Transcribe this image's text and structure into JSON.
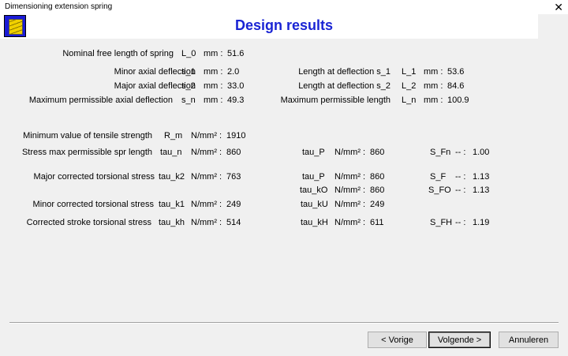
{
  "window": {
    "title": "Dimensioning extension spring",
    "close_glyph": "✕"
  },
  "heading": "Design results",
  "rows": {
    "free_length": {
      "label": "Nominal free length of spring",
      "sym": "L_0",
      "unit": "mm :",
      "val": "51.6"
    },
    "s1": {
      "label": "Minor axial deflection",
      "sym": "s_1",
      "unit": "mm :",
      "val": "2.0"
    },
    "s2": {
      "label": "Major axial deflection",
      "sym": "s_2",
      "unit": "mm :",
      "val": "33.0"
    },
    "sn": {
      "label": "Maximum permissible axial deflection",
      "sym": "s_n",
      "unit": "mm :",
      "val": "49.3"
    },
    "L1": {
      "label": "Length at deflection s_1",
      "sym": "L_1",
      "unit": "mm :",
      "val": "53.6"
    },
    "L2": {
      "label": "Length at deflection s_2",
      "sym": "L_2",
      "unit": "mm :",
      "val": "84.6"
    },
    "Ln": {
      "label": "Maximum permissible length",
      "sym": "L_n",
      "unit": "mm :",
      "val": "100.9"
    },
    "Rm": {
      "label": "Minimum value of tensile strength",
      "sym": "R_m",
      "unit": "N/mm² :",
      "val": "1910"
    },
    "taun": {
      "label": "Stress max permissible spr length",
      "sym": "tau_n",
      "unit": "N/mm² :",
      "val": "860"
    },
    "tauk2": {
      "label": "Major corrected torsional stress",
      "sym": "tau_k2",
      "unit": "N/mm² :",
      "val": "763"
    },
    "tauk1": {
      "label": "Minor corrected torsional stress",
      "sym": "tau_k1",
      "unit": "N/mm² :",
      "val": "249"
    },
    "taukh": {
      "label": "Corrected stroke torsional stress",
      "sym": "tau_kh",
      "unit": "N/mm² :",
      "val": "514"
    },
    "tauP1": {
      "sym": "tau_P",
      "unit": "N/mm² :",
      "val": "860"
    },
    "tauP2": {
      "sym": "tau_P",
      "unit": "N/mm² :",
      "val": "860"
    },
    "tauk0": {
      "sym": "tau_kO",
      "unit": "N/mm² :",
      "val": "860"
    },
    "taukU": {
      "sym": "tau_kU",
      "unit": "N/mm² :",
      "val": "249"
    },
    "taukH": {
      "sym": "tau_kH",
      "unit": "N/mm² :",
      "val": "611"
    },
    "SFn": {
      "sym": "S_Fn",
      "unit": "-- :",
      "val": "1.00"
    },
    "SF": {
      "sym": "S_F",
      "unit": "-- :",
      "val": "1.13"
    },
    "SFO": {
      "sym": "S_FO",
      "unit": "-- :",
      "val": "1.13"
    },
    "SFH": {
      "sym": "S_FH",
      "unit": "-- :",
      "val": "1.19"
    }
  },
  "buttons": {
    "back": "< Vorige",
    "next": "Volgende >",
    "cancel": "Annuleren"
  }
}
